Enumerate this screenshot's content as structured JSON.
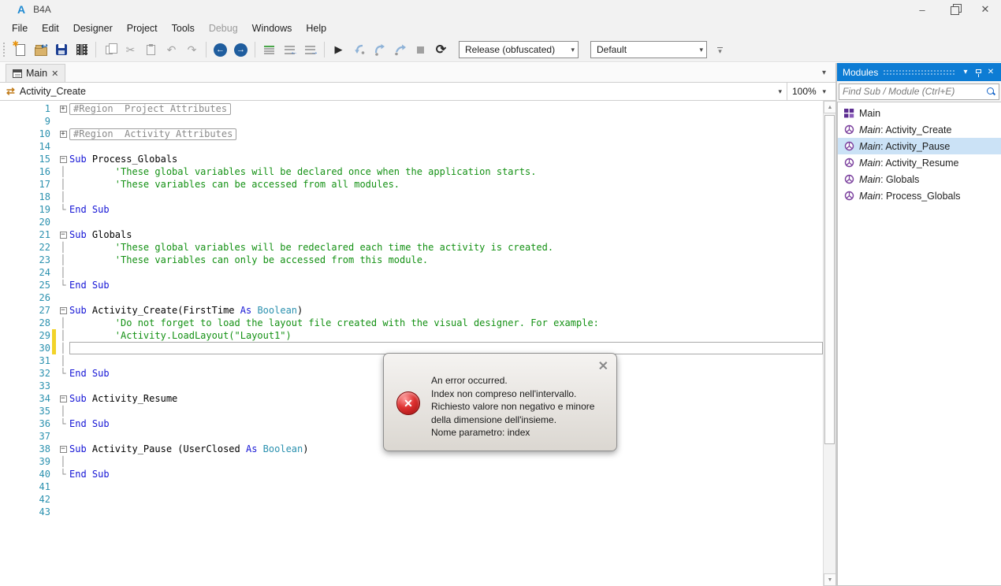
{
  "colors": {
    "accent": "#0d7cd4",
    "sel": "#cbe2f6",
    "kw": "#1616d6",
    "cm": "#149114",
    "ty": "#2b91af",
    "ln": "#2b91af",
    "mark": "#f2d329"
  },
  "titlebar": {
    "logo": "A",
    "app": "B4A"
  },
  "icons": {
    "minimize": "–",
    "close": "✕",
    "back": "←",
    "forward": "→",
    "undo": "↶",
    "redo": "↷",
    "cut": "✂",
    "play": "▶",
    "restart": "⟳",
    "dropdown": "▾",
    "up_arrow": "▲",
    "down_arrow": "▼",
    "tab_close": "✕",
    "nav_icon": "⇄",
    "outdent_arrow": "←",
    "indent_arrow": "→",
    "open_arrow": "↩"
  },
  "menu": {
    "items": [
      {
        "label": "File",
        "enabled": true
      },
      {
        "label": "Edit",
        "enabled": true
      },
      {
        "label": "Designer",
        "enabled": true
      },
      {
        "label": "Project",
        "enabled": true
      },
      {
        "label": "Tools",
        "enabled": true
      },
      {
        "label": "Debug",
        "enabled": false
      },
      {
        "label": "Windows",
        "enabled": true
      },
      {
        "label": "Help",
        "enabled": true
      }
    ]
  },
  "toolbar": {
    "build_config": "Release (obfuscated)",
    "ui_variant": "Default"
  },
  "tab": {
    "label": "Main"
  },
  "navbar": {
    "context": "Activity_Create",
    "zoom": "100%"
  },
  "editor": {
    "lines": [
      {
        "n": 1,
        "fold": "plus",
        "seg": [
          [
            "rg",
            "#Region  Project Attributes"
          ]
        ]
      },
      {
        "n": 9,
        "fold": "",
        "seg": []
      },
      {
        "n": 10,
        "fold": "plus",
        "seg": [
          [
            "rg",
            "#Region  Activity Attributes"
          ]
        ]
      },
      {
        "n": 14,
        "fold": "",
        "seg": []
      },
      {
        "n": 15,
        "fold": "minus",
        "seg": [
          [
            "kw",
            "Sub"
          ],
          [
            "pl",
            " Process_Globals"
          ]
        ]
      },
      {
        "n": 16,
        "fold": "pipe",
        "seg": [
          [
            "cm",
            "        'These global variables will be declared once when the application starts."
          ]
        ]
      },
      {
        "n": 17,
        "fold": "pipe",
        "seg": [
          [
            "cm",
            "        'These variables can be accessed from all modules."
          ]
        ]
      },
      {
        "n": 18,
        "fold": "pipe",
        "seg": []
      },
      {
        "n": 19,
        "fold": "corner",
        "seg": [
          [
            "kw",
            "End Sub"
          ]
        ]
      },
      {
        "n": 20,
        "fold": "",
        "seg": []
      },
      {
        "n": 21,
        "fold": "minus",
        "seg": [
          [
            "kw",
            "Sub"
          ],
          [
            "pl",
            " Globals"
          ]
        ]
      },
      {
        "n": 22,
        "fold": "pipe",
        "seg": [
          [
            "cm",
            "        'These global variables will be redeclared each time the activity is created."
          ]
        ]
      },
      {
        "n": 23,
        "fold": "pipe",
        "seg": [
          [
            "cm",
            "        'These variables can only be accessed from this module."
          ]
        ]
      },
      {
        "n": 24,
        "fold": "pipe",
        "seg": []
      },
      {
        "n": 25,
        "fold": "corner",
        "seg": [
          [
            "kw",
            "End Sub"
          ]
        ]
      },
      {
        "n": 26,
        "fold": "",
        "seg": []
      },
      {
        "n": 27,
        "fold": "minus",
        "seg": [
          [
            "kw",
            "Sub"
          ],
          [
            "pl",
            " Activity_Create(FirstTime "
          ],
          [
            "kw",
            "As"
          ],
          [
            "pl",
            " "
          ],
          [
            "ty",
            "Boolean"
          ],
          [
            "pl",
            ")"
          ]
        ]
      },
      {
        "n": 28,
        "fold": "pipe",
        "seg": [
          [
            "cm",
            "        'Do not forget to load the layout file created with the visual designer. For example:"
          ]
        ]
      },
      {
        "n": 29,
        "fold": "pipe",
        "mark": true,
        "seg": [
          [
            "cm",
            "        'Activity.LoadLayout(\"Layout1\")"
          ]
        ]
      },
      {
        "n": 30,
        "fold": "pipe",
        "mark": true,
        "cur": true,
        "seg": []
      },
      {
        "n": 31,
        "fold": "pipe",
        "seg": []
      },
      {
        "n": 32,
        "fold": "corner",
        "seg": [
          [
            "kw",
            "End Sub"
          ]
        ]
      },
      {
        "n": 33,
        "fold": "",
        "seg": []
      },
      {
        "n": 34,
        "fold": "minus",
        "seg": [
          [
            "kw",
            "Sub"
          ],
          [
            "pl",
            " Activity_Resume"
          ]
        ]
      },
      {
        "n": 35,
        "fold": "pipe",
        "seg": []
      },
      {
        "n": 36,
        "fold": "corner",
        "seg": [
          [
            "kw",
            "End Sub"
          ]
        ]
      },
      {
        "n": 37,
        "fold": "",
        "seg": []
      },
      {
        "n": 38,
        "fold": "minus",
        "seg": [
          [
            "kw",
            "Sub"
          ],
          [
            "pl",
            " Activity_Pause (UserClosed "
          ],
          [
            "kw",
            "As"
          ],
          [
            "pl",
            " "
          ],
          [
            "ty",
            "Boolean"
          ],
          [
            "pl",
            ")"
          ]
        ]
      },
      {
        "n": 39,
        "fold": "pipe",
        "seg": []
      },
      {
        "n": 40,
        "fold": "corner",
        "seg": [
          [
            "kw",
            "End Sub"
          ]
        ]
      },
      {
        "n": 41,
        "fold": "",
        "seg": []
      },
      {
        "n": 42,
        "fold": "",
        "seg": []
      },
      {
        "n": 43,
        "fold": "",
        "seg": []
      }
    ]
  },
  "error_dialog": {
    "lines": [
      "An error occurred.",
      "Index non compreso nell'intervallo.",
      "Richiesto valore non negativo e minore",
      "della dimensione dell'insieme.",
      "Nome parametro: index"
    ]
  },
  "modules": {
    "title": "Modules",
    "search_placeholder": "Find Sub / Module (Ctrl+E)",
    "items": [
      {
        "icon": "module",
        "prefix": "",
        "name": "Main",
        "selected": false
      },
      {
        "icon": "sub",
        "prefix": "Main",
        "name": "Activity_Create",
        "selected": false
      },
      {
        "icon": "sub",
        "prefix": "Main",
        "name": "Activity_Pause",
        "selected": true
      },
      {
        "icon": "sub",
        "prefix": "Main",
        "name": "Activity_Resume",
        "selected": false
      },
      {
        "icon": "sub",
        "prefix": "Main",
        "name": "Globals",
        "selected": false
      },
      {
        "icon": "sub",
        "prefix": "Main",
        "name": "Process_Globals",
        "selected": false
      }
    ]
  }
}
